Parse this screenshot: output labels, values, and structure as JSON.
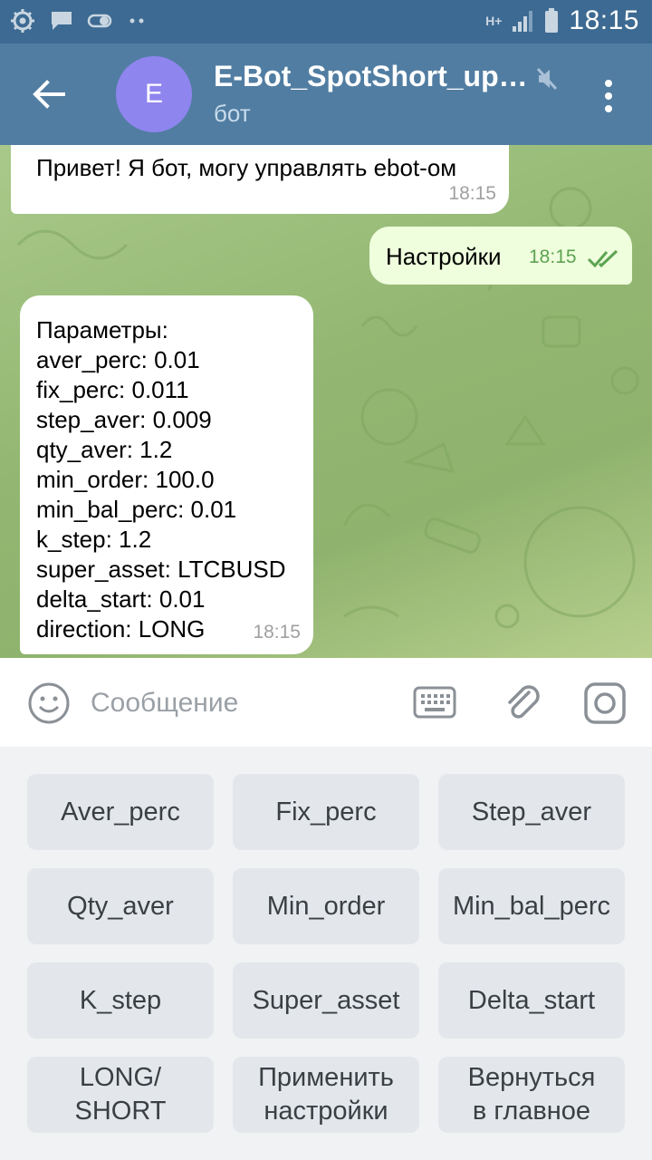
{
  "status_bar": {
    "time": "18:15",
    "network": "H+",
    "left_icons": [
      "settings-gear-icon",
      "chat-notification-icon",
      "toggle-icon",
      "more-dots-icon"
    ]
  },
  "header": {
    "avatar_letter": "E",
    "title": "E-Bot_SpotShort_up…",
    "subtitle": "бот",
    "muted": true,
    "colors": {
      "status_bar": "#3d6a92",
      "header": "#517da2",
      "avatar": "#8e85ee"
    }
  },
  "messages": [
    {
      "type": "incoming",
      "text": "Привет! Я бот, могу управлять ebot-ом",
      "time": "18:15"
    },
    {
      "type": "outgoing",
      "text": "Настройки",
      "time": "18:15",
      "read": true
    },
    {
      "type": "incoming",
      "lines": [
        "Параметры:",
        "aver_perc: 0.01",
        "fix_perc: 0.011",
        "step_aver: 0.009",
        "qty_aver: 1.2",
        "min_order: 100.0",
        "min_bal_perc: 0.01",
        "k_step: 1.2",
        "super_asset: LTCBUSD",
        "delta_start: 0.01",
        "direction: LONG"
      ],
      "time": "18:15"
    }
  ],
  "input": {
    "placeholder": "Сообщение"
  },
  "keyboard": {
    "rows": [
      [
        "Aver_perc",
        "Fix_perc",
        "Step_aver"
      ],
      [
        "Qty_aver",
        "Min_order",
        "Min_bal_perc"
      ],
      [
        "K_step",
        "Super_asset",
        "Delta_start"
      ],
      [
        "LONG/\nSHORT",
        "Применить\nнастройки",
        "Вернуться\nв главное"
      ]
    ]
  }
}
